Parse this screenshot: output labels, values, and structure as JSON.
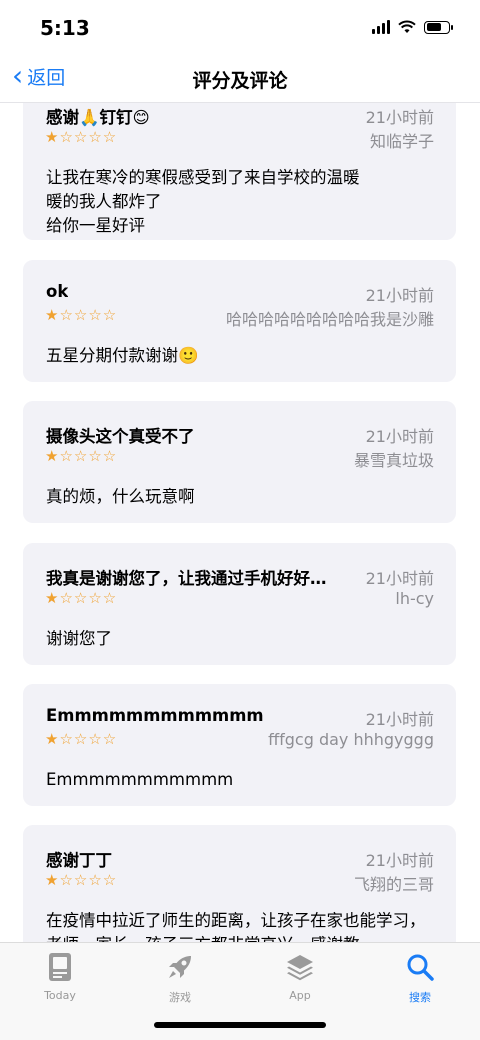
{
  "status": {
    "time": "5:13"
  },
  "nav": {
    "back_label": "返回",
    "title": "评分及评论"
  },
  "reviews": [
    {
      "title": "感谢🙏钉钉😊",
      "date": "21小时前",
      "author": "知临学子",
      "rating": 1,
      "body": "让我在寒冷的寒假感受到了来自学校的温暖\n暖的我人都炸了\n给你一星好评"
    },
    {
      "title": "ok",
      "date": "21小时前",
      "author": "哈哈哈哈哈哈哈哈哈我是沙雕",
      "rating": 1,
      "body": "五星分期付款谢谢🙂"
    },
    {
      "title": "摄像头这个真受不了",
      "date": "21小时前",
      "author": "暴雪真垃圾",
      "rating": 1,
      "body": "真的烦，什么玩意啊"
    },
    {
      "title": "我真是谢谢您了，让我通过手机好好…",
      "date": "21小时前",
      "author": "lh-cy",
      "rating": 1,
      "body": "谢谢您了"
    },
    {
      "title": "Emmmmmmmmmmmm",
      "date": "21小时前",
      "author": "fffgcg day hhhgyggg",
      "rating": 1,
      "body": "Emmmmmmmmmmm"
    },
    {
      "title": "感谢丁丁",
      "date": "21小时前",
      "author": "飞翔的三哥",
      "rating": 1,
      "body": "在疫情中拉近了师生的距离，让孩子在家也能学习，老师，家长，孩子三方都非常高兴，感谢教"
    }
  ],
  "tabs": [
    {
      "label": "Today",
      "icon": "today-icon"
    },
    {
      "label": "游戏",
      "icon": "rocket-icon"
    },
    {
      "label": "App",
      "icon": "layers-icon"
    },
    {
      "label": "搜索",
      "icon": "search-icon",
      "active": true
    }
  ],
  "colors": {
    "accent": "#1a7cf5",
    "star": "#f0a231",
    "card_bg": "#f2f2f7"
  }
}
